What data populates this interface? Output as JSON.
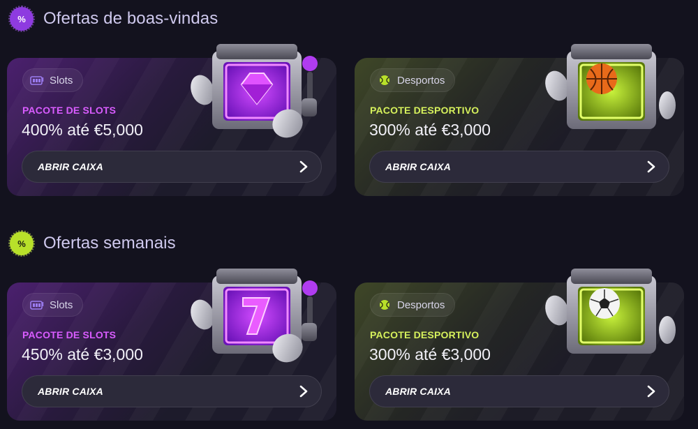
{
  "sections": [
    {
      "title": "Ofertas de boas-vindas",
      "badge_text": "%",
      "cards": [
        {
          "tag": "Slots",
          "tag_icon": "slot-machine-icon",
          "label": "PACOTE DE SLOTS",
          "amount": "400% até €5,000",
          "button": "ABRIR CAIXA",
          "chest_icon": "gem-icon"
        },
        {
          "tag": "Desportos",
          "tag_icon": "tennis-ball-icon",
          "label": "PACOTE DESPORTIVO",
          "amount": "300% até €3,000",
          "button": "ABRIR CAIXA",
          "chest_icon": "basketball-icon"
        }
      ]
    },
    {
      "title": "Ofertas semanais",
      "badge_text": "%",
      "cards": [
        {
          "tag": "Slots",
          "tag_icon": "slot-machine-icon",
          "label": "PACOTE DE SLOTS",
          "amount": "450% até €3,000",
          "button": "ABRIR CAIXA",
          "chest_icon": "seven-icon"
        },
        {
          "tag": "Desportos",
          "tag_icon": "tennis-ball-icon",
          "label": "PACOTE DESPORTIVO",
          "amount": "300% até €3,000",
          "button": "ABRIR CAIXA",
          "chest_icon": "soccer-ball-icon"
        }
      ]
    }
  ],
  "colors": {
    "background": "#13121e",
    "slots_accent": "#d95cff",
    "sports_accent": "#d6f15c",
    "purple_badge": "#8e3be0",
    "lime_badge": "#b8e02a"
  }
}
